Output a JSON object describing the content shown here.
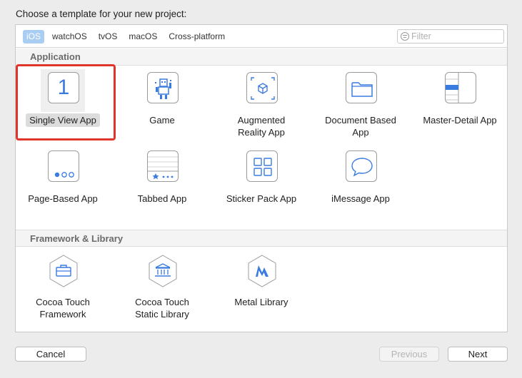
{
  "dialog": {
    "heading": "Choose a template for your new project:"
  },
  "platform_tabs": [
    {
      "label": "iOS",
      "selected": true
    },
    {
      "label": "watchOS",
      "selected": false
    },
    {
      "label": "tvOS",
      "selected": false
    },
    {
      "label": "macOS",
      "selected": false
    },
    {
      "label": "Cross-platform",
      "selected": false
    }
  ],
  "filter": {
    "placeholder": "Filter",
    "value": ""
  },
  "sections": {
    "application": {
      "title": "Application",
      "items": [
        {
          "label": "Single View App",
          "icon": "single-view-icon",
          "selected": true
        },
        {
          "label": "Game",
          "icon": "game-icon",
          "selected": false
        },
        {
          "label": "Augmented\nReality App",
          "icon": "augmented-reality-icon",
          "selected": false
        },
        {
          "label": "Document Based\nApp",
          "icon": "document-based-icon",
          "selected": false
        },
        {
          "label": "Master-Detail App",
          "icon": "master-detail-icon",
          "selected": false
        },
        {
          "label": "Page-Based App",
          "icon": "page-based-icon",
          "selected": false
        },
        {
          "label": "Tabbed App",
          "icon": "tabbed-icon",
          "selected": false
        },
        {
          "label": "Sticker Pack App",
          "icon": "sticker-pack-icon",
          "selected": false
        },
        {
          "label": "iMessage App",
          "icon": "imessage-icon",
          "selected": false
        }
      ]
    },
    "framework": {
      "title": "Framework & Library",
      "items": [
        {
          "label": "Cocoa Touch\nFramework",
          "icon": "toolbox-icon"
        },
        {
          "label": "Cocoa Touch\nStatic Library",
          "icon": "library-building-icon"
        },
        {
          "label": "Metal Library",
          "icon": "metal-icon"
        }
      ]
    }
  },
  "icon_text": {
    "single_view_number": "1"
  },
  "buttons": {
    "cancel": "Cancel",
    "previous": "Previous",
    "next": "Next"
  },
  "colors": {
    "accent_blue": "#3a7be0",
    "selected_tab": "#aacdf3",
    "highlight_red": "#e0352b"
  }
}
